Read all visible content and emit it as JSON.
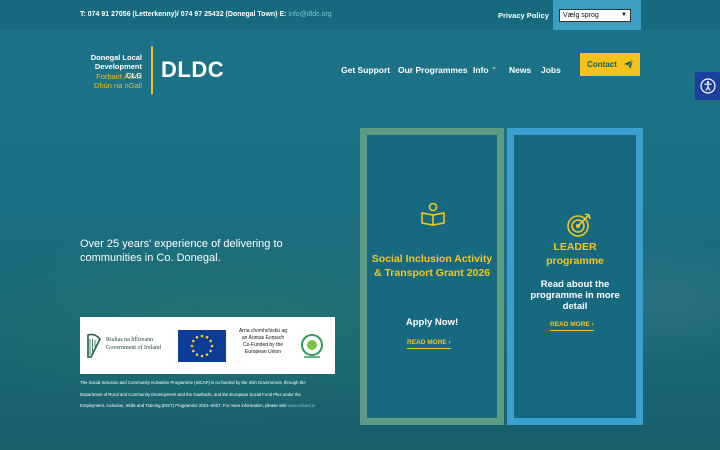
{
  "topbar": {
    "contact_text": "T: 074 91 27056 (Letterkenny)/ 074 97 25432 (Donegal Town)  E: ",
    "email": "info@dldc.org",
    "privacy_label": "Privacy Policy",
    "language_select": "Vælg sprog"
  },
  "logo": {
    "name_line1": "Donegal Local",
    "name_line2": "Development CLG",
    "irish_line1": "Forbairt Áitiúil",
    "irish_line2": "Dhún na nGall",
    "mark": "DLDC"
  },
  "nav": {
    "items": [
      "Get Support",
      "Our Programmes",
      "Info",
      "News",
      "Jobs"
    ],
    "contact_label": "Contact"
  },
  "hero": {
    "text": "Over 25 years' experience of delivering to communities in Co. Donegal."
  },
  "funding": {
    "gov_line1": "Rialtas na hÉireann",
    "gov_line2": "Government of Ireland",
    "eu_line1": "Arna chomhchistiú ag",
    "eu_line2": "an Aontas Eorpach",
    "eu_line3": "Co-Funded by the",
    "eu_line4": "European Union",
    "note": "The Social Inclusion and Community Activation Programme (SICAP) is co-funded by the Irish Government, through the Department of Rural and Community Development and the Gaeltacht, and the European Social Fund Plus under the Employment, Inclusion, Skills and Training (EIST) Programme 2021–2027. For more information, please visit ",
    "link": "www.esfund.ie"
  },
  "cards": [
    {
      "title": "Social Inclusion Activity & Transport Grant 2026",
      "subtitle": "Apply Now!",
      "read_more": "READ MORE",
      "icon": "open-book-person-icon"
    },
    {
      "title": "LEADER programme",
      "subtitle": "Read about the programme in more detail",
      "read_more": "READ MORE",
      "icon": "target-arrow-icon"
    }
  ],
  "colors": {
    "accent_yellow": "#f3c31c",
    "card1_border": "#5e9b84",
    "card2_border": "#3b9fd0",
    "background": "#1a6f80"
  }
}
